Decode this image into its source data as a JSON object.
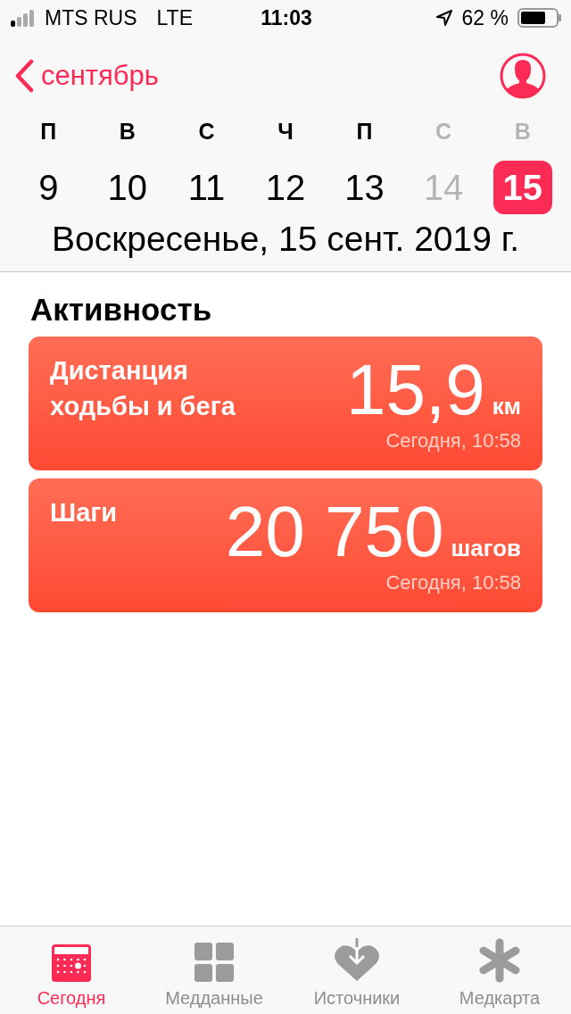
{
  "status_bar": {
    "carrier": "MTS RUS",
    "network": "LTE",
    "time": "11:03",
    "battery": "62 %"
  },
  "header": {
    "back_label": "сентябрь"
  },
  "week": [
    {
      "weekday": "П",
      "day": "9",
      "selected": false,
      "dimmed": false
    },
    {
      "weekday": "В",
      "day": "10",
      "selected": false,
      "dimmed": false
    },
    {
      "weekday": "С",
      "day": "11",
      "selected": false,
      "dimmed": false
    },
    {
      "weekday": "Ч",
      "day": "12",
      "selected": false,
      "dimmed": false
    },
    {
      "weekday": "П",
      "day": "13",
      "selected": false,
      "dimmed": false
    },
    {
      "weekday": "С",
      "day": "14",
      "selected": false,
      "dimmed": true
    },
    {
      "weekday": "В",
      "day": "15",
      "selected": true,
      "dimmed": true
    }
  ],
  "date_title": "Воскресенье, 15 сент. 2019 г.",
  "section_title": "Активность",
  "cards": [
    {
      "title": "Дистанция ходьбы и бега",
      "value": "15,9",
      "unit": "км",
      "time": "Сегодня, 10:58"
    },
    {
      "title": "Шаги",
      "value": "20 750",
      "unit": "шагов",
      "time": "Сегодня, 10:58"
    }
  ],
  "tabs": [
    {
      "label": "Сегодня",
      "kind": "today",
      "selected": true
    },
    {
      "label": "Медданные",
      "kind": "data",
      "selected": false
    },
    {
      "label": "Источники",
      "kind": "sources",
      "selected": false
    },
    {
      "label": "Медкарта",
      "kind": "medical",
      "selected": false
    }
  ]
}
